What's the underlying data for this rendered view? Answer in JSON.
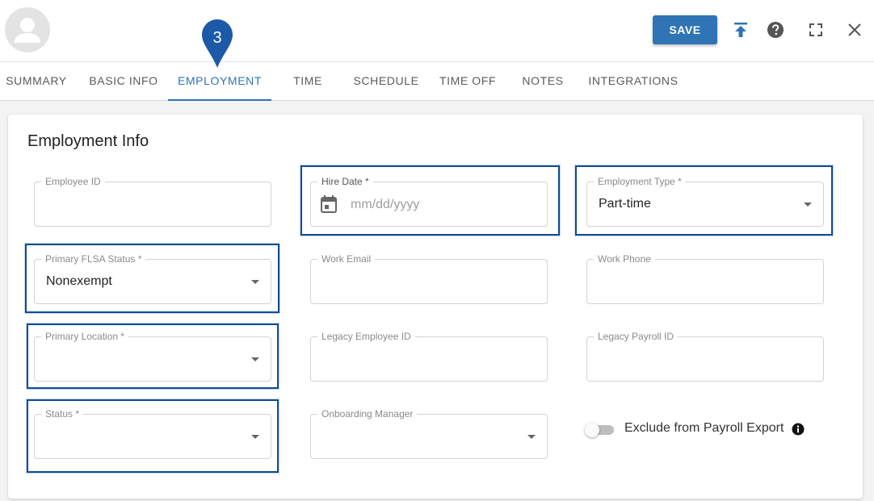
{
  "header": {
    "save_label": "SAVE",
    "icons": [
      "avatar-icon",
      "upload-icon",
      "help-icon",
      "fullscreen-icon",
      "close-icon"
    ]
  },
  "tabs": [
    {
      "label": "SUMMARY"
    },
    {
      "label": "BASIC INFO"
    },
    {
      "label": "EMPLOYMENT",
      "active": true
    },
    {
      "label": "TIME"
    },
    {
      "label": "SCHEDULE"
    },
    {
      "label": "TIME OFF"
    },
    {
      "label": "NOTES"
    },
    {
      "label": "INTEGRATIONS"
    }
  ],
  "step_marker": "3",
  "form": {
    "title": "Employment Info",
    "employee_id": {
      "label": "Employee ID",
      "value": ""
    },
    "hire_date": {
      "label": "Hire Date *",
      "placeholder": "mm/dd/yyyy"
    },
    "employment_type": {
      "label": "Employment Type *",
      "value": "Part-time"
    },
    "flsa_status": {
      "label": "Primary FLSA Status *",
      "value": "Nonexempt"
    },
    "work_email": {
      "label": "Work Email",
      "value": ""
    },
    "work_phone": {
      "label": "Work Phone",
      "value": ""
    },
    "primary_location": {
      "label": "Primary Location *",
      "value": ""
    },
    "legacy_employee_id": {
      "label": "Legacy Employee ID",
      "value": ""
    },
    "legacy_payroll_id": {
      "label": "Legacy Payroll ID",
      "value": ""
    },
    "status": {
      "label": "Status *",
      "value": ""
    },
    "onboarding_manager": {
      "label": "Onboarding Manager",
      "value": ""
    },
    "exclude_payroll_export": {
      "label": "Exclude from Payroll Export",
      "checked": false
    }
  },
  "colors": {
    "accent": "#2f74b5",
    "highlight": "#0f4c92"
  }
}
